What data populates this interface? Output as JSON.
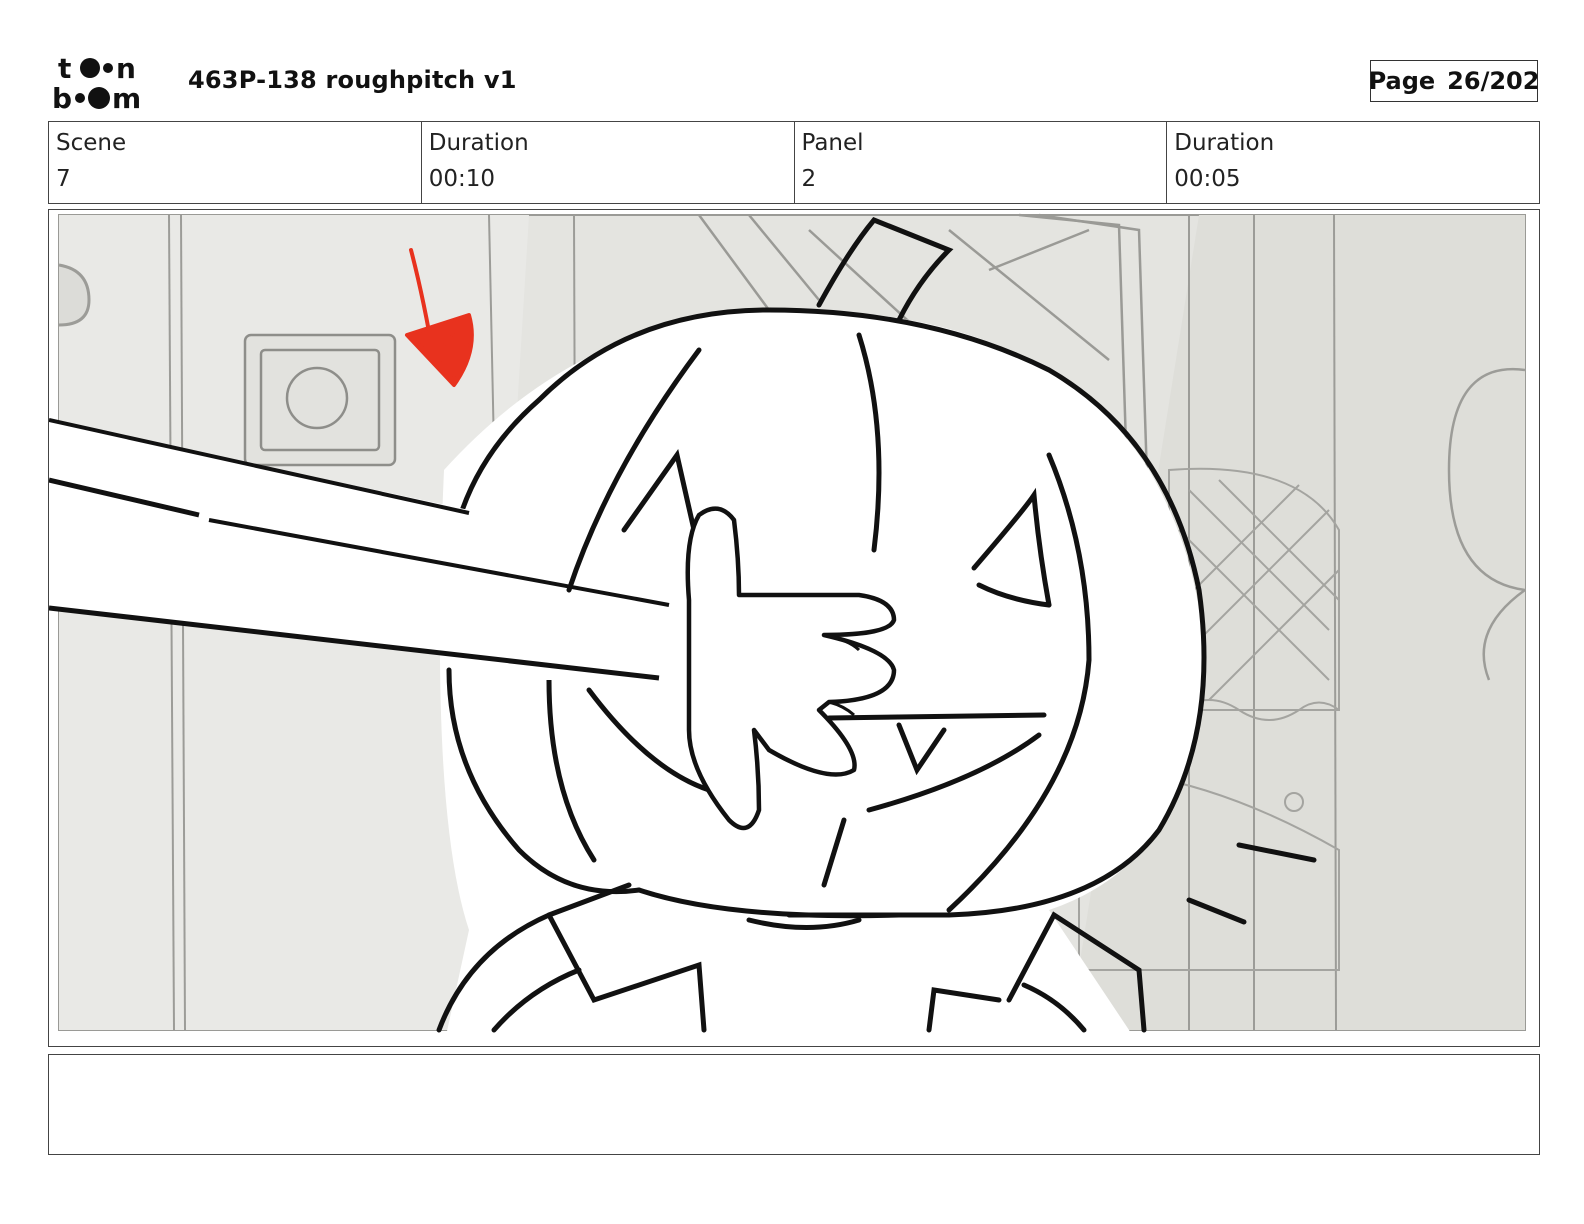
{
  "header": {
    "logo_top": "toon",
    "logo_bottom": "boom",
    "title": "463P-138 roughpitch v1",
    "page_label": "Page",
    "page_value": "26/202"
  },
  "info": {
    "scene_label": "Scene",
    "scene_value": "7",
    "scene_duration_label": "Duration",
    "scene_duration_value": "00:10",
    "panel_label": "Panel",
    "panel_value": "2",
    "panel_duration_label": "Duration",
    "panel_duration_value": "00:05"
  },
  "notes": {
    "text": ""
  },
  "colors": {
    "annotation_arrow": "#e8321e",
    "background_wall": "#e4e4e0",
    "line_art": "#111111"
  }
}
